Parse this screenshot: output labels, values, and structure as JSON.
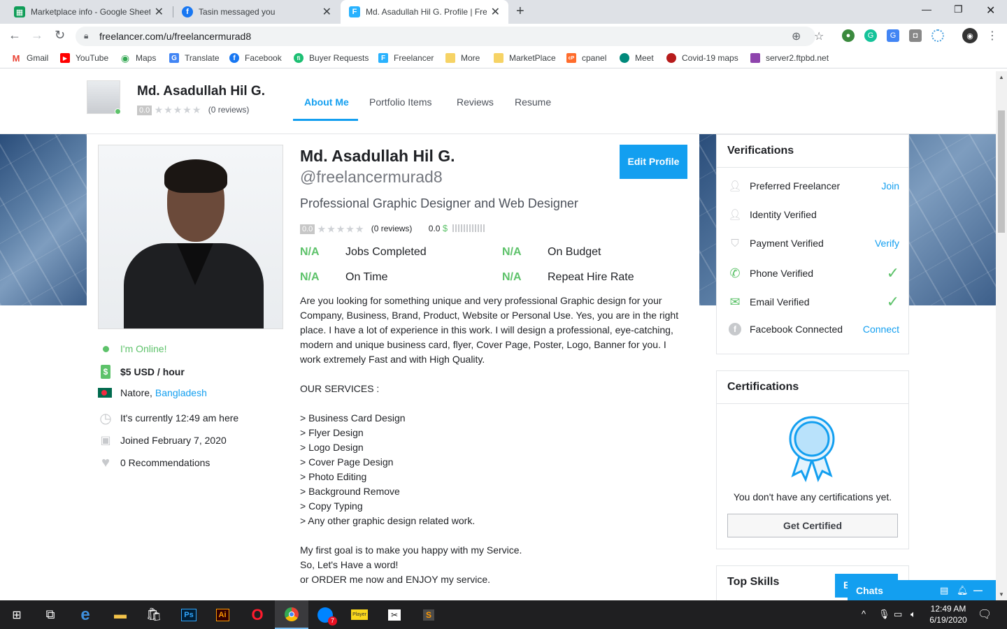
{
  "browser": {
    "tabs": [
      {
        "title": "Marketplace info - Google Sheets",
        "icon": "sheets-icon",
        "color": "#0f9d58"
      },
      {
        "title": "Tasin messaged you",
        "icon": "facebook-icon",
        "color": "#1877f2"
      },
      {
        "title": "Md. Asadullah Hil G. Profile | Freelancer",
        "icon": "freelancer-icon",
        "color": "#29b2fe"
      }
    ],
    "new_tab": "+",
    "url": "freelancer.com/u/freelancermurad8",
    "bookmarks": [
      {
        "label": "Gmail",
        "icon": "gmail-icon",
        "color": "#ea4335",
        "glyph": "M"
      },
      {
        "label": "YouTube",
        "icon": "youtube-icon",
        "color": "#ff0000",
        "glyph": "▶"
      },
      {
        "label": "Maps",
        "icon": "maps-icon",
        "color": "#34a853",
        "glyph": "◉"
      },
      {
        "label": "Translate",
        "icon": "translate-icon",
        "color": "#4285f4",
        "glyph": "G"
      },
      {
        "label": "Facebook",
        "icon": "facebook-icon",
        "color": "#1877f2",
        "glyph": "f"
      },
      {
        "label": "Buyer Requests",
        "icon": "fiverr-icon",
        "color": "#1dbf73",
        "glyph": "fi"
      },
      {
        "label": "Freelancer",
        "icon": "freelancer-icon",
        "color": "#29b2fe",
        "glyph": "F"
      },
      {
        "label": "More",
        "icon": "folder-icon",
        "color": "#f6d365",
        "glyph": ""
      },
      {
        "label": "MarketPlace",
        "icon": "folder-icon",
        "color": "#f6d365",
        "glyph": ""
      },
      {
        "label": "cpanel",
        "icon": "cpanel-icon",
        "color": "#ff6c2c",
        "glyph": "cP"
      },
      {
        "label": "Meet",
        "icon": "meet-icon",
        "color": "#00897b",
        "glyph": "●"
      },
      {
        "label": "Covid-19 maps",
        "icon": "covid-icon",
        "color": "#b71c1c",
        "glyph": "●"
      },
      {
        "label": "server2.ftpbd.net",
        "icon": "server-icon",
        "color": "#8e44ad",
        "glyph": "▦"
      }
    ]
  },
  "subheader": {
    "name": "Md. Asadullah Hil G.",
    "rating": "0.0",
    "stars": "★★★★★",
    "reviews": "(0 reviews)",
    "tabs": [
      "About Me",
      "Portfolio Items",
      "Reviews",
      "Resume"
    ]
  },
  "profile": {
    "online": "I'm Online!",
    "rate": "$5 USD / hour",
    "city": "Natore, ",
    "country": "Bangladesh",
    "time": "It's currently 12:49 am here",
    "joined": "Joined February 7, 2020",
    "recommendations": "0 Recommendations",
    "name": "Md. Asadullah Hil G.",
    "handle": "@freelancermurad8",
    "tagline": "Professional Graphic Designer and Web Designer",
    "rating": "0.0",
    "stars": "★★★★★",
    "reviews": "(0 reviews)",
    "earnings": "0.0",
    "currency": "$",
    "edit_button": "Edit Profile",
    "stats": [
      {
        "value": "N/A",
        "label": "Jobs Completed"
      },
      {
        "value": "N/A",
        "label": "On Budget"
      },
      {
        "value": "N/A",
        "label": "On Time"
      },
      {
        "value": "N/A",
        "label": "Repeat Hire Rate"
      }
    ],
    "description": [
      "Are you looking for something unique and very professional Graphic design for your Company, Business, Brand, Product, Website or Personal Use. Yes, you are in the right place. I have a lot of experience in this work. I will design a professional, eye-catching, modern and unique business card, flyer, Cover Page, Poster, Logo, Banner for you. I work extremely Fast and with High Quality.",
      "",
      "OUR SERVICES :",
      "",
      "> Business Card Design",
      "> Flyer Design",
      "> Logo Design",
      "> Cover Page Design",
      "> Photo Editing",
      "> Background Remove",
      "> Copy Typing",
      "> Any other graphic design related work.",
      "",
      "My first goal is to make you happy with my Service.",
      "So, Let's Have a word!",
      "or ORDER me now and ENJOY my service."
    ]
  },
  "verifications": {
    "title": "Verifications",
    "items": [
      {
        "label": "Preferred Freelancer",
        "action": "Join"
      },
      {
        "label": "Identity Verified",
        "action": ""
      },
      {
        "label": "Payment Verified",
        "action": "Verify"
      },
      {
        "label": "Phone Verified",
        "action": "✓"
      },
      {
        "label": "Email Verified",
        "action": "✓"
      },
      {
        "label": "Facebook Connected",
        "action": "Connect"
      }
    ]
  },
  "certifications": {
    "title": "Certifications",
    "empty_text": "You don't have any certifications yet.",
    "button": "Get Certified"
  },
  "skills": {
    "title": "Top Skills",
    "button_partial": "E"
  },
  "chat": {
    "label": "Chats"
  },
  "taskbar": {
    "time": "12:49 AM",
    "date": "6/19/2020",
    "messenger_badge": "7"
  },
  "colors": {
    "accent": "#139ff0",
    "success": "#5dc26a"
  }
}
